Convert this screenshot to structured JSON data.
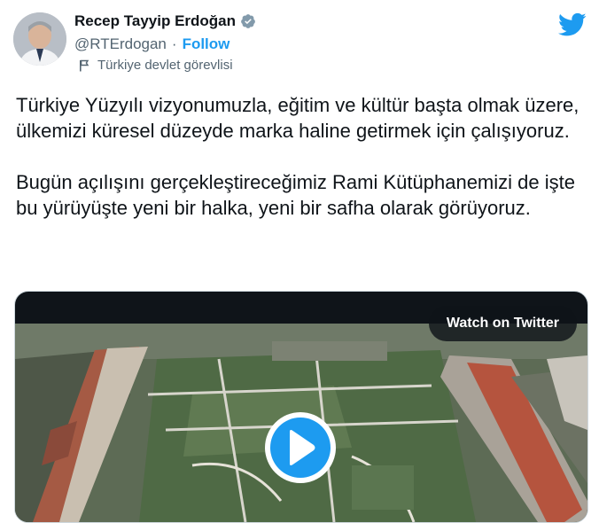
{
  "author": {
    "name": "Recep Tayyip Erdoğan",
    "handle": "@RTErdogan",
    "separator": "·",
    "follow_label": "Follow",
    "account_label": "Türkiye devlet görevlisi"
  },
  "tweet": {
    "paragraph1": "Türkiye Yüzyılı vizyonumuzla, eğitim ve kültür başta olmak üzere, ülkemizi küresel düzeyde marka haline getirmek için çalışıyoruz.",
    "paragraph2": "Bugün açılışını gerçekleştireceğimiz Rami Kütüphanemizi de işte bu yürüyüşte yeni bir halka, yeni bir safha olarak görüyoruz."
  },
  "media": {
    "watch_label": "Watch on Twitter"
  },
  "icons": {
    "verified": "verified-badge-icon",
    "label": "flag-icon",
    "brand": "twitter-bird-icon",
    "play": "play-icon"
  },
  "colors": {
    "accent": "#1d9bf0",
    "text": "#0f1419",
    "secondary": "#536471"
  }
}
